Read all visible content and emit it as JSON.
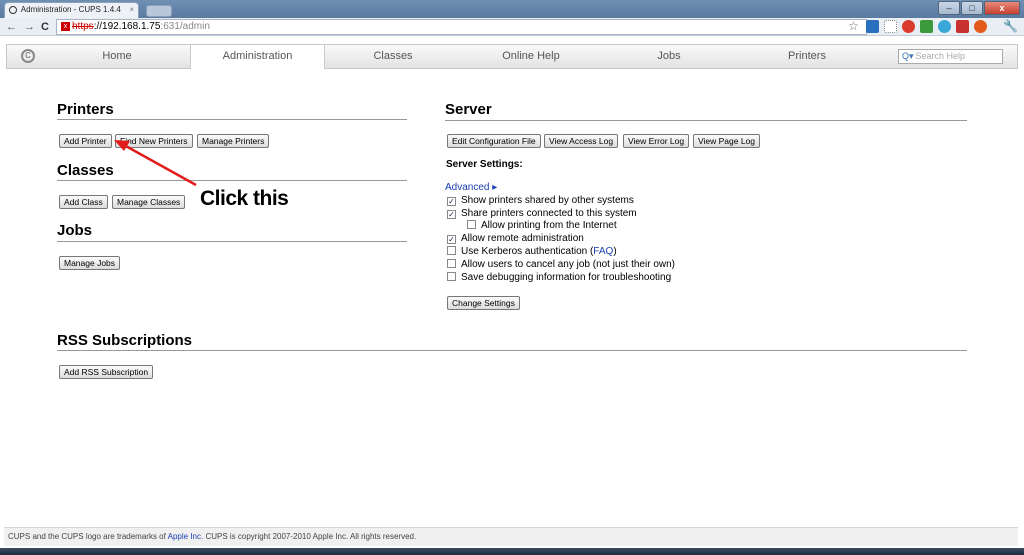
{
  "browser": {
    "tab_title": "Administration - CUPS 1.4.4",
    "tab_close": "×",
    "url_scheme": "https",
    "url_host": "://192.168.1.75",
    "url_path": ":631/admin",
    "window_buttons": {
      "minimize": "–",
      "maximize": "□",
      "close": "x"
    }
  },
  "nav": {
    "items": [
      "Home",
      "Administration",
      "Classes",
      "Online Help",
      "Jobs",
      "Printers"
    ],
    "active": "Administration",
    "search_placeholder": "Search Help"
  },
  "printers": {
    "heading": "Printers",
    "buttons": [
      "Add Printer",
      "Find New Printers",
      "Manage Printers"
    ]
  },
  "classes": {
    "heading": "Classes",
    "buttons": [
      "Add Class",
      "Manage Classes"
    ]
  },
  "jobs": {
    "heading": "Jobs",
    "buttons": [
      "Manage Jobs"
    ]
  },
  "server": {
    "heading": "Server",
    "buttons": [
      "Edit Configuration File",
      "View Access Log",
      "View Error Log",
      "View Page Log"
    ],
    "settings_title": "Server Settings:",
    "advanced_link": "Advanced ▸",
    "options": [
      {
        "label": "Show printers shared by other systems",
        "checked": true
      },
      {
        "label": "Share printers connected to this system",
        "checked": true
      },
      {
        "label": "Allow printing from the Internet",
        "checked": false
      },
      {
        "label": "Allow remote administration",
        "checked": true
      },
      {
        "label": "Use Kerberos authentication (",
        "link": "FAQ",
        "suffix": ")",
        "checked": false
      },
      {
        "label": "Allow users to cancel any job (not just their own)",
        "checked": false
      },
      {
        "label": "Save debugging information for troubleshooting",
        "checked": false
      }
    ],
    "change_button": "Change Settings"
  },
  "rss": {
    "heading": "RSS Subscriptions",
    "button": "Add RSS Subscription"
  },
  "annotation": {
    "text": "Click this",
    "color": "#e21b1b"
  },
  "footer": {
    "prefix": "CUPS and the CUPS logo are trademarks of ",
    "link": "Apple Inc.",
    "suffix": " CUPS is copyright 2007-2010 Apple Inc. All rights reserved."
  },
  "icons": {
    "back": "back-arrow-icon",
    "forward": "forward-arrow-icon",
    "reload": "reload-icon",
    "star": "bookmark-star-icon",
    "wrench": "wrench-icon"
  }
}
